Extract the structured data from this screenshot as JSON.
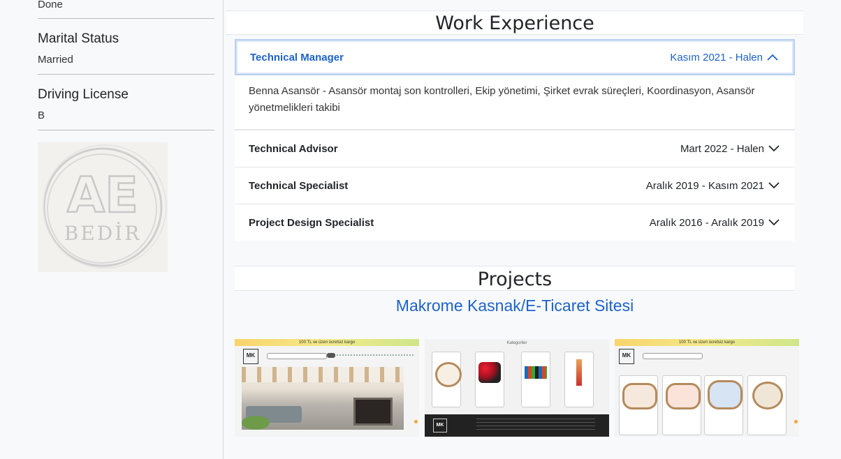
{
  "sidebar": {
    "top_value": "Done",
    "marital": {
      "title": "Marital Status",
      "value": "Married"
    },
    "driving": {
      "title": "Driving License",
      "value": "B"
    },
    "logo": {
      "initials": "AE",
      "name": "BEDİR"
    }
  },
  "work": {
    "title": "Work Experience",
    "items": [
      {
        "role": "Technical Manager",
        "dates": "Kasım 2021 - Halen",
        "open": true,
        "description": "Benna Asansör - Asansör montaj son kontrolleri, Ekip yönetimi, Şirket evrak süreçleri, Koordinasyon, Asansör yönetmelikleri takibi"
      },
      {
        "role": "Technical Advisor",
        "dates": "Mart 2022 - Halen",
        "open": false
      },
      {
        "role": "Technical Specialist",
        "dates": "Aralık 2019 - Kasım 2021",
        "open": false
      },
      {
        "role": "Project Design Specialist",
        "dates": "Aralık 2016 - Aralık 2019",
        "open": false
      }
    ]
  },
  "projects": {
    "title": "Projects",
    "project_title": "Makrome Kasnak/E-Ticaret Sitesi",
    "thumbs": {
      "banner": "100 TL ve üzeri ücretsiz kargo",
      "categories_heading": "Kategoriler",
      "brand": "MK"
    }
  },
  "colors": {
    "accent": "#1c62c9",
    "background": "#f8f9fa"
  }
}
